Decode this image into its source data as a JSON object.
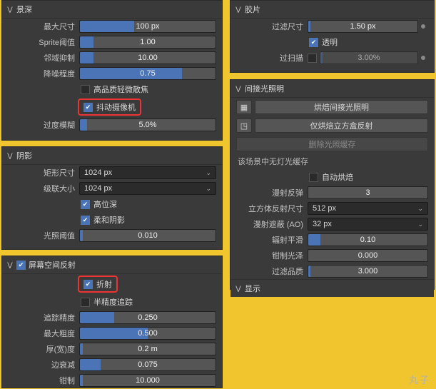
{
  "dof": {
    "title": "景深",
    "max_size_label": "最大尺寸",
    "max_size": "100 px",
    "sprite_label": "Sprite阈值",
    "sprite": "1.00",
    "neighbor_label": "邻域抑制",
    "neighbor": "10.00",
    "denoise_label": "降噪程度",
    "denoise": "0.75",
    "hq_label": "高品质轻微散焦",
    "jitter_label": "抖动摄像机",
    "overblur_label": "过度模糊",
    "overblur": "5.0%"
  },
  "shadow": {
    "title": "阴影",
    "cube_label": "矩形尺寸",
    "cube": "1024 px",
    "cascade_label": "级联大小",
    "cascade": "1024 px",
    "high_bit_label": "高位深",
    "soft_label": "柔和阴影",
    "threshold_label": "光照阈值",
    "threshold": "0.010"
  },
  "ssr": {
    "title": "屏幕空间反射",
    "refraction_label": "折射",
    "half_res_label": "半精度追踪",
    "trace_label": "追踪精度",
    "trace": "0.250",
    "max_rough_label": "最大粗度",
    "max_rough": "0.500",
    "thickness_label": "厚(宽)度",
    "thickness": "0.2 m",
    "edge_label": "边衰减",
    "edge": "0.075",
    "clamp_label": "钳制",
    "clamp": "10.000"
  },
  "film": {
    "title": "胶片",
    "filter_label": "过滤尺寸",
    "filter": "1.50 px",
    "transparent_label": "透明",
    "overscan_label": "过扫描",
    "overscan": "3.00%"
  },
  "gi": {
    "title": "间接光照明",
    "bake_btn": "烘焙间接光照明",
    "bake_cubemap_btn": "仅烘焙立方盒反射",
    "delete_btn": "删除光照缓存",
    "no_cache": "该场景中无灯光缓存",
    "auto_bake_label": "自动烘焙",
    "bounces_label": "漫射反弹",
    "bounces": "3",
    "cubemap_size_label": "立方体反射尺寸",
    "cubemap_size": "512 px",
    "ao_label": "漫射遮蔽 (AO)",
    "ao": "32 px",
    "irr_smooth_label": "辐射平滑",
    "irr_smooth": "0.10",
    "glossy_clamp_label": "钳制光泽",
    "glossy_clamp": "0.000",
    "filter_q_label": "过滤品质",
    "filter_q": "3.000",
    "display_title": "显示"
  },
  "watermark": "丸子"
}
